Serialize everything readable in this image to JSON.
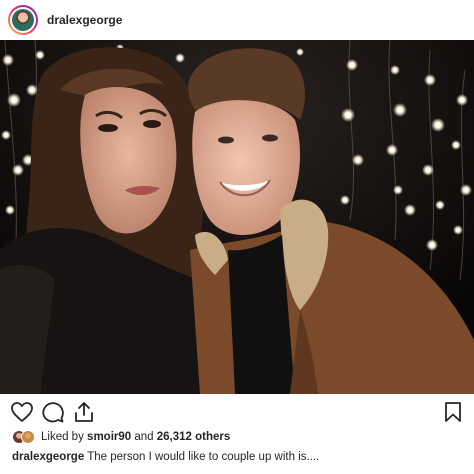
{
  "header": {
    "username": "dralexgeorge",
    "avatar_icon": "profile-avatar"
  },
  "post": {
    "photo_description_icon": "couple-selfie-photo",
    "colors": {
      "story_ring_start": "#f9ce34",
      "story_ring_mid": "#ee2a7b",
      "story_ring_end": "#6228d7"
    }
  },
  "actions": {
    "like_icon": "heart-icon",
    "comment_icon": "comment-icon",
    "share_icon": "share-icon",
    "save_icon": "bookmark-icon"
  },
  "likes": {
    "prefix": "Liked by",
    "user": "smoir90",
    "connector": "and",
    "count": "26,312 others"
  },
  "caption": {
    "username": "dralexgeorge",
    "text": "The person I would like to couple up with is...."
  }
}
